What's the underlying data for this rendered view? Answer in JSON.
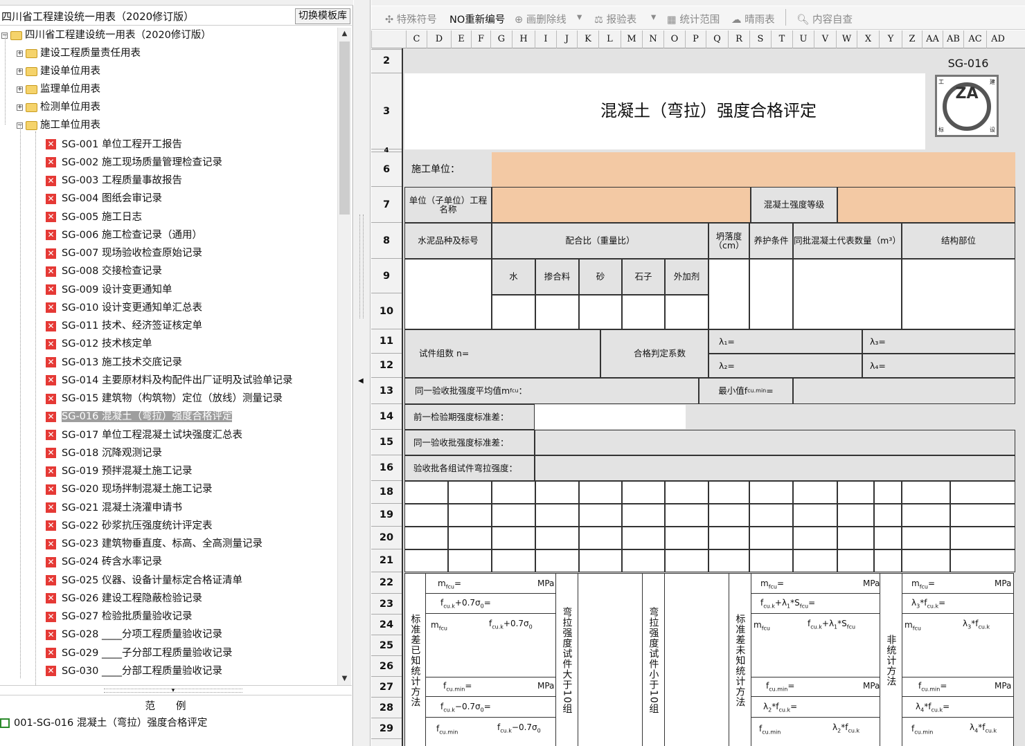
{
  "tree": {
    "title": "四川省工程建设统一用表（2020修订版）",
    "switch_btn": "切换模板库",
    "root": "四川省工程建设统一用表（2020修订版）",
    "folders": [
      "建设工程质量责任用表",
      "建设单位用表",
      "监理单位用表",
      "检测单位用表",
      "施工单位用表"
    ],
    "items": [
      "SG-001 单位工程开工报告",
      "SG-002 施工现场质量管理检查记录",
      "SG-003 工程质量事故报告",
      "SG-004 图纸会审记录",
      "SG-005 施工日志",
      "SG-006 施工检查记录（通用）",
      "SG-007 现场验收检查原始记录",
      "SG-008 交接检查记录",
      "SG-009 设计变更通知单",
      "SG-010 设计变更通知单汇总表",
      "SG-011 技术、经济签证核定单",
      "SG-012 技术核定单",
      "SG-013 施工技术交底记录",
      "SG-014 主要原材料及构配件出厂证明及试验单记录",
      "SG-015 建筑物（构筑物）定位（放线）测量记录",
      "SG-016 混凝土（弯拉）强度合格评定",
      "SG-017 单位工程混凝土试块强度汇总表",
      "SG-018 沉降观测记录",
      "SG-019 预拌混凝土施工记录",
      "SG-020 现场拌制混凝土施工记录",
      "SG-021 混凝土浇灌申请书",
      "SG-022 砂浆抗压强度统计评定表",
      "SG-023 建筑物垂直度、标高、全高测量记录",
      "SG-024 砖含水率记录",
      "SG-025 仪器、设备计量标定合格证清单",
      "SG-026 建设工程隐蔽检验记录",
      "SG-027 检验批质量验收记录",
      "SG-028 ____分项工程质量验收记录",
      "SG-029 ____子分部工程质量验收记录",
      "SG-030 ____分部工程质量验收记录"
    ],
    "selected_index": 15,
    "example_header": "范例",
    "example_item": "001-SG-016 混凝土（弯拉）强度合格评定"
  },
  "toolbar": {
    "special": "特殊符号",
    "renumber": "NO重新编号",
    "strike": "画删除线",
    "check": "报验表",
    "stat": "统计范围",
    "rain": "晴雨表",
    "self": "内容自查"
  },
  "columns": [
    "C",
    "D",
    "E",
    "F",
    "G",
    "H",
    "I",
    "J",
    "K",
    "L",
    "M",
    "N",
    "O",
    "P",
    "Q",
    "R",
    "S",
    "T",
    "U",
    "V",
    "W",
    "X",
    "Y",
    "Z",
    "AA",
    "AB",
    "AC",
    "AD"
  ],
  "rows": [
    "2",
    "3",
    "4",
    "6",
    "7",
    "8",
    "9",
    "10",
    "11",
    "12",
    "13",
    "14",
    "15",
    "16",
    "18",
    "19",
    "20",
    "21",
    "22",
    "23",
    "24",
    "25",
    "26",
    "27",
    "28",
    "29"
  ],
  "form": {
    "code": "SG-016",
    "logo": "ZA",
    "logo_corners": [
      "工",
      "建",
      "标",
      "设"
    ],
    "title": "混凝土（弯拉）强度合格评定",
    "unit_label": "施工单位：",
    "proj_label": "单位（子单位）工程名称",
    "grade_label": "混凝土强度等级",
    "cement": "水泥品种及标号",
    "mix": "配合比（重量比）",
    "slump": "坍落度（cm）",
    "cure": "养护条件",
    "batch_qty": "同批混凝土代表数量（m³）",
    "part": "结构部位",
    "water": "水",
    "admix": "掺合料",
    "sand": "砂",
    "stone": "石子",
    "additive": "外加剂",
    "n_label": "试件组数 n=",
    "coef_label": "合格判定系数",
    "l1": "λ₁=",
    "l2": "λ₂=",
    "l3": "λ₃=",
    "l4": "λ₄=",
    "avg_label": "同一验收批强度平均值m",
    "min_label": "最小值f",
    "prev_sd": "前一检验期强度标准差：",
    "same_sd": "同一验收批强度标准差：",
    "each_group": "验收批各组试件弯拉强度：",
    "v_known": "标准差已知统计方法",
    "v_gt10": "弯拉强度试件大于10组",
    "v_lt10": "弯拉强度试件小于10组",
    "v_unknown": "标准差未知统计方法",
    "v_nonstat": "非统计方法",
    "mpa": "MPa"
  }
}
